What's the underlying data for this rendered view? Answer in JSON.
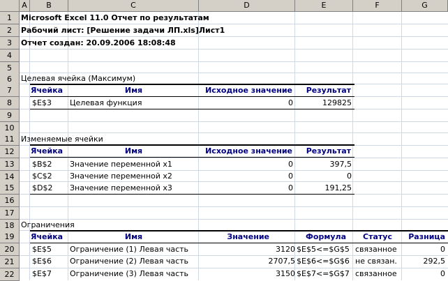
{
  "columns": [
    "A",
    "B",
    "C",
    "D",
    "E",
    "F",
    "G"
  ],
  "rows": [
    "1",
    "2",
    "3",
    "4",
    "5",
    "6",
    "7",
    "8",
    "9",
    "10",
    "11",
    "12",
    "13",
    "14",
    "15",
    "16",
    "17",
    "18",
    "19",
    "20",
    "21",
    "22"
  ],
  "report": {
    "title": "Microsoft Excel 11.0 Отчет по результатам",
    "sheet": "Рабочий лист: [Решение задачи ЛП.xls]Лист1",
    "created": "Отчет создан: 20.09.2006 18:08:48"
  },
  "target": {
    "section": "Целевая ячейка (Максимум)",
    "headers": [
      "Ячейка",
      "Имя",
      "Исходное значение",
      "Результат"
    ],
    "rows": [
      {
        "cell": "$E$3",
        "name": "Целевая функция",
        "initial": "0",
        "result": "129825"
      }
    ]
  },
  "variables": {
    "section": "Изменяемые ячейки",
    "headers": [
      "Ячейка",
      "Имя",
      "Исходное значение",
      "Результат"
    ],
    "rows": [
      {
        "cell": "$B$2",
        "name": "Значение переменной x1",
        "initial": "0",
        "result": "397,5"
      },
      {
        "cell": "$C$2",
        "name": "Значение переменной x2",
        "initial": "0",
        "result": "0"
      },
      {
        "cell": "$D$2",
        "name": "Значение переменной x3",
        "initial": "0",
        "result": "191,25"
      }
    ]
  },
  "constraints": {
    "section": "Ограничения",
    "headers": [
      "Ячейка",
      "Имя",
      "Значение",
      "Формула",
      "Статус",
      "Разница"
    ],
    "rows": [
      {
        "cell": "$E$5",
        "name": "Ограничение (1) Левая часть",
        "value": "3120",
        "formula": "$E$5<=$G$5",
        "status": "связанное",
        "diff": "0"
      },
      {
        "cell": "$E$6",
        "name": "Ограничение (2) Левая часть",
        "value": "2707,5",
        "formula": "$E$6<=$G$6",
        "status": "не связан.",
        "diff": "292,5"
      },
      {
        "cell": "$E$7",
        "name": "Ограничение (3) Левая часть",
        "value": "3150",
        "formula": "$E$7<=$G$7",
        "status": "связанное",
        "diff": "0"
      }
    ]
  }
}
